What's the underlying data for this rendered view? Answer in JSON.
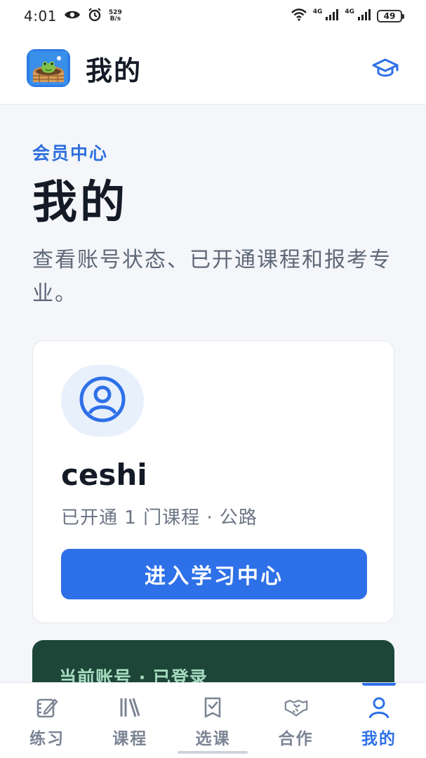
{
  "status_bar": {
    "time": "4:01",
    "net_speed_value": "529",
    "net_speed_unit": "B/s",
    "network_1": "4G",
    "network_2": "4G",
    "battery": "49"
  },
  "app_bar": {
    "title": "我的",
    "logo_icon": "frog-in-well-logo",
    "action_icon": "graduation-cap-icon"
  },
  "main": {
    "eyebrow": "会员中心",
    "heading": "我的",
    "description": "查看账号状态、已开通课程和报考专业。"
  },
  "profile_card": {
    "avatar_icon": "user-circle-icon",
    "username": "ceshi",
    "course_info": "已开通 1 门课程 · 公路",
    "enter_button_label": "进入学习中心"
  },
  "account_card": {
    "status": "当前账号 · 已登录"
  },
  "bottom_nav": {
    "items": [
      {
        "label": "练习",
        "icon": "edit-note-icon"
      },
      {
        "label": "课程",
        "icon": "books-icon"
      },
      {
        "label": "选课",
        "icon": "checklist-icon"
      },
      {
        "label": "合作",
        "icon": "handshake-icon"
      },
      {
        "label": "我的",
        "icon": "person-icon",
        "active": true
      }
    ]
  },
  "colors": {
    "accent": "#2e70e8",
    "background": "#f4f6f9",
    "account_card": "#1d4638"
  }
}
